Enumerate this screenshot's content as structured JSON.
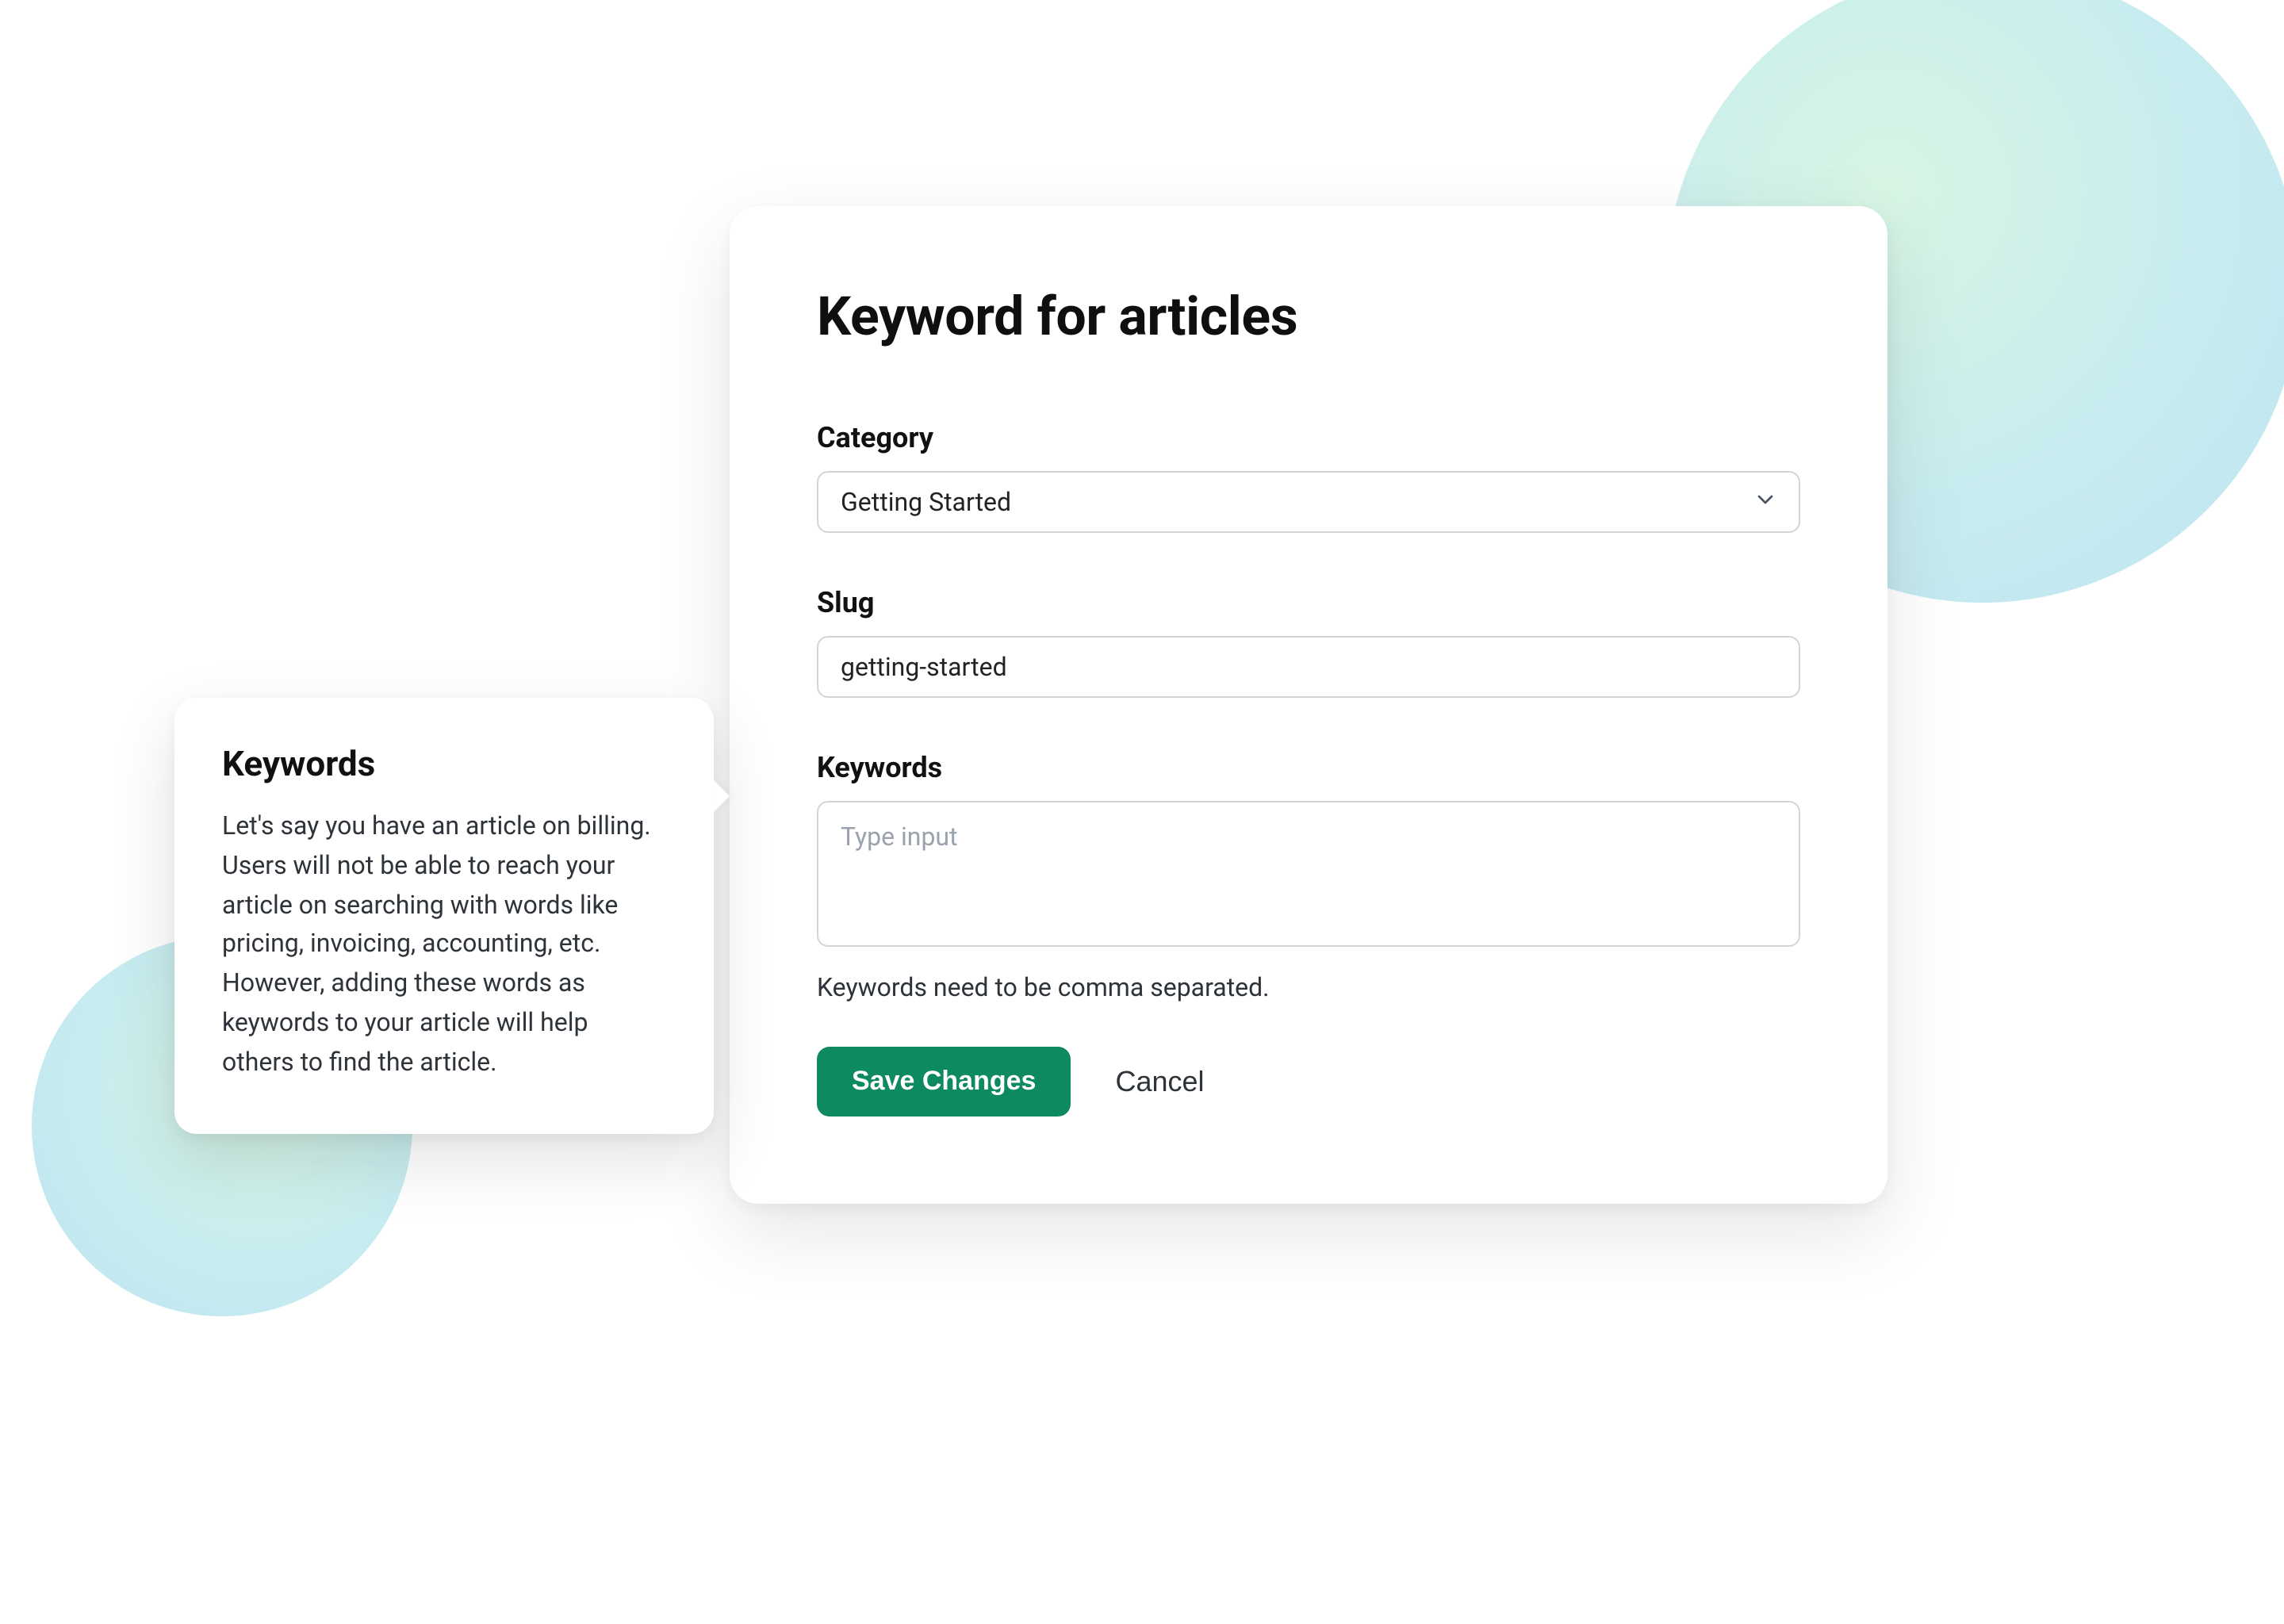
{
  "main": {
    "title": "Keyword for articles",
    "category": {
      "label": "Category",
      "selected": "Getting Started"
    },
    "slug": {
      "label": "Slug",
      "value": "getting-started"
    },
    "keywords": {
      "label": "Keywords",
      "placeholder": "Type input",
      "helper": "Keywords need to be comma separated."
    },
    "actions": {
      "save": "Save Changes",
      "cancel": "Cancel"
    }
  },
  "tooltip": {
    "title": "Keywords",
    "body": "Let's say you have an article on billing. Users will not be able to reach your article on searching with words like pricing, invoicing, accounting, etc. However, adding these words as keywords to your article will help others to find the article."
  },
  "colors": {
    "primary": "#0d8a5f"
  }
}
